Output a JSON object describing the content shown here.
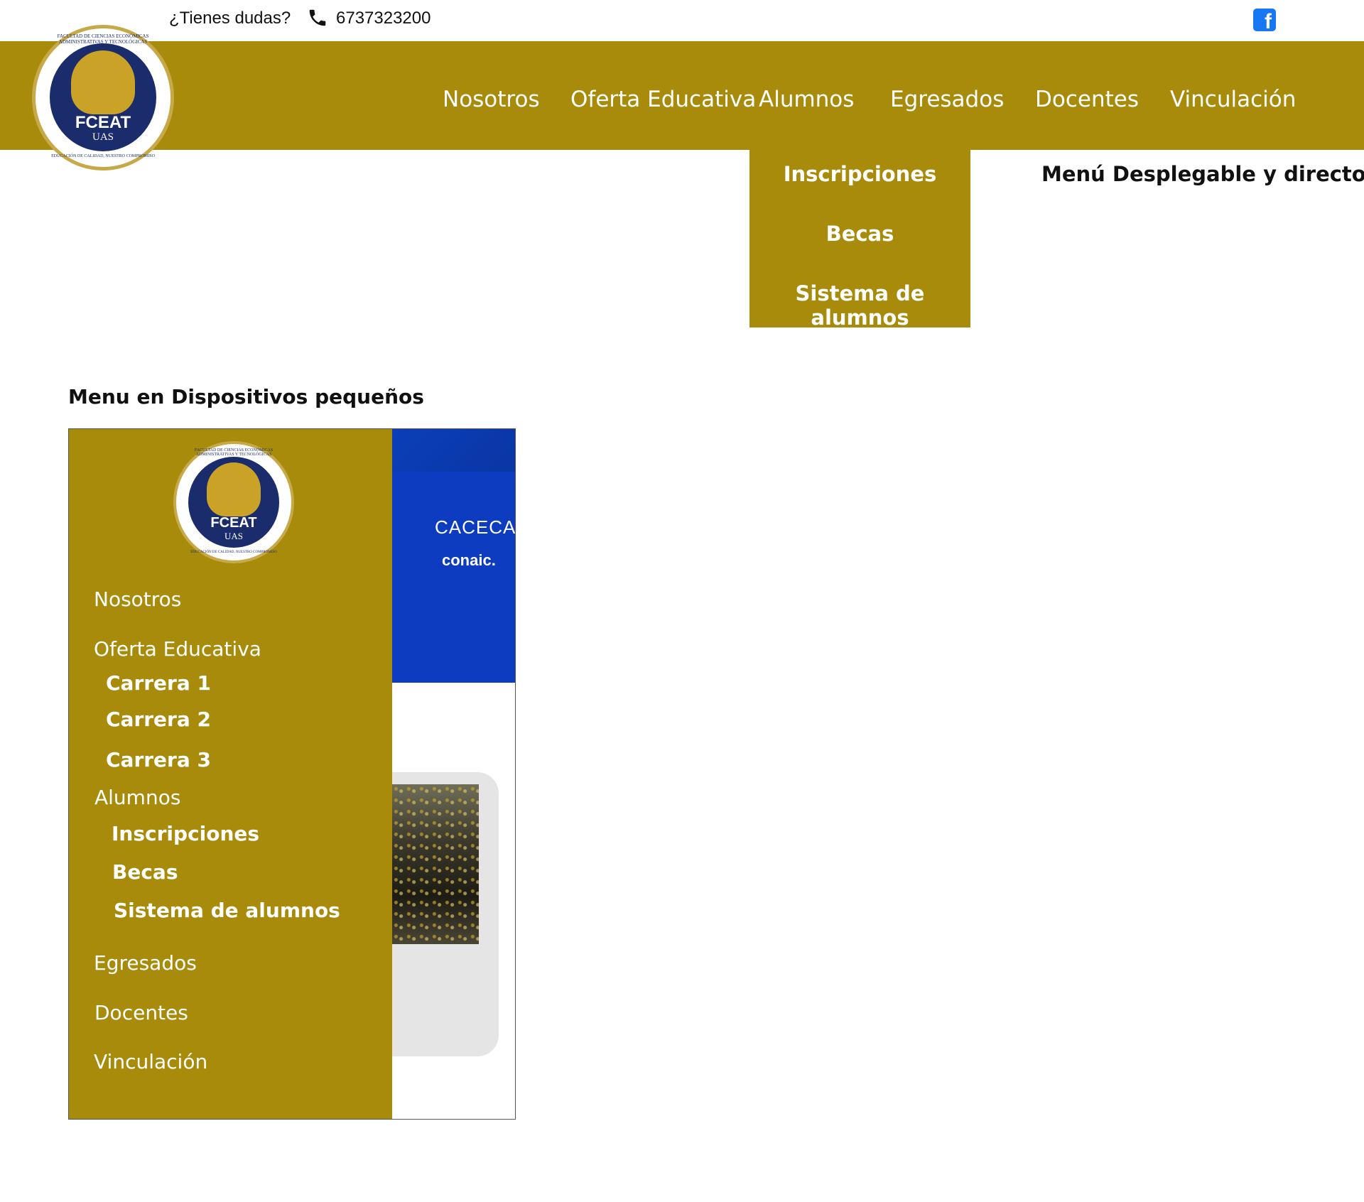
{
  "topbar": {
    "question": "¿Tienes dudas?",
    "phone": "6737323200",
    "phone_icon": "phone-icon",
    "social_icon": "facebook-icon",
    "facebook_letter": "f"
  },
  "logo": {
    "name": "FCEAT",
    "sub": "UAS",
    "arc_top": "FACULTAD DE CIENCIAS ECONÓMICAS ADMINISTRATIVAS Y TECNOLÓGICAS",
    "arc_bottom": "EDUCACIÓN DE CALIDAD, NUESTRO COMPROMISO"
  },
  "nav": {
    "items": [
      "Nosotros",
      "Oferta Educativa",
      "Alumnos",
      "Egresados",
      "Docentes",
      "Vinculación"
    ]
  },
  "dropdown": {
    "items": [
      "Inscripciones",
      "Becas",
      "Sistema de alumnos"
    ],
    "note": "Menú Desplegable y directo"
  },
  "mobile": {
    "heading": "Menu en Dispositivos pequeños",
    "menu": {
      "nosotros": "Nosotros",
      "oferta": "Oferta Educativa",
      "carreras": [
        "Carrera 1",
        "Carrera 2",
        "Carrera 3"
      ],
      "alumnos": "Alumnos",
      "alumnos_sub": [
        "Inscripciones",
        "Becas",
        "Sistema de alumnos"
      ],
      "egresados": "Egresados",
      "docentes": "Docentes",
      "vinculacion": "Vinculación"
    },
    "banner": {
      "caceca": "CACECA",
      "conaic": "conaic."
    }
  },
  "colors": {
    "brand_gold": "#a88b0a",
    "navy": "#1a2c6b",
    "facebook_blue": "#1877f2"
  }
}
